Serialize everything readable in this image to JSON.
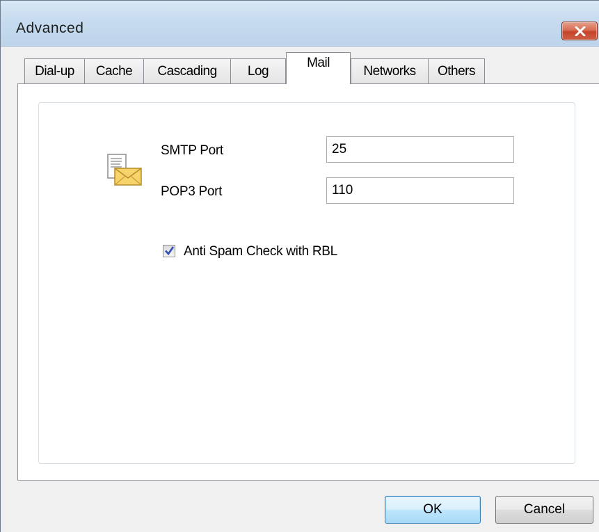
{
  "window": {
    "title": "Advanced",
    "close_icon": "close-icon",
    "close_color": "#c4442a"
  },
  "tabs": [
    {
      "label": "Dial-up",
      "active": false
    },
    {
      "label": "Cache",
      "active": false
    },
    {
      "label": "Cascading",
      "active": false
    },
    {
      "label": "Log",
      "active": false
    },
    {
      "label": "Mail",
      "active": true
    },
    {
      "label": "Networks",
      "active": false
    },
    {
      "label": "Others",
      "active": false
    }
  ],
  "mail": {
    "icon": "mail-envelope-icon",
    "smtp_label": "SMTP Port",
    "smtp_value": "25",
    "pop3_label": "POP3 Port",
    "pop3_value": "110",
    "antispam_label": "Anti Spam Check with RBL",
    "antispam_checked": true
  },
  "buttons": {
    "ok": "OK",
    "cancel": "Cancel"
  }
}
